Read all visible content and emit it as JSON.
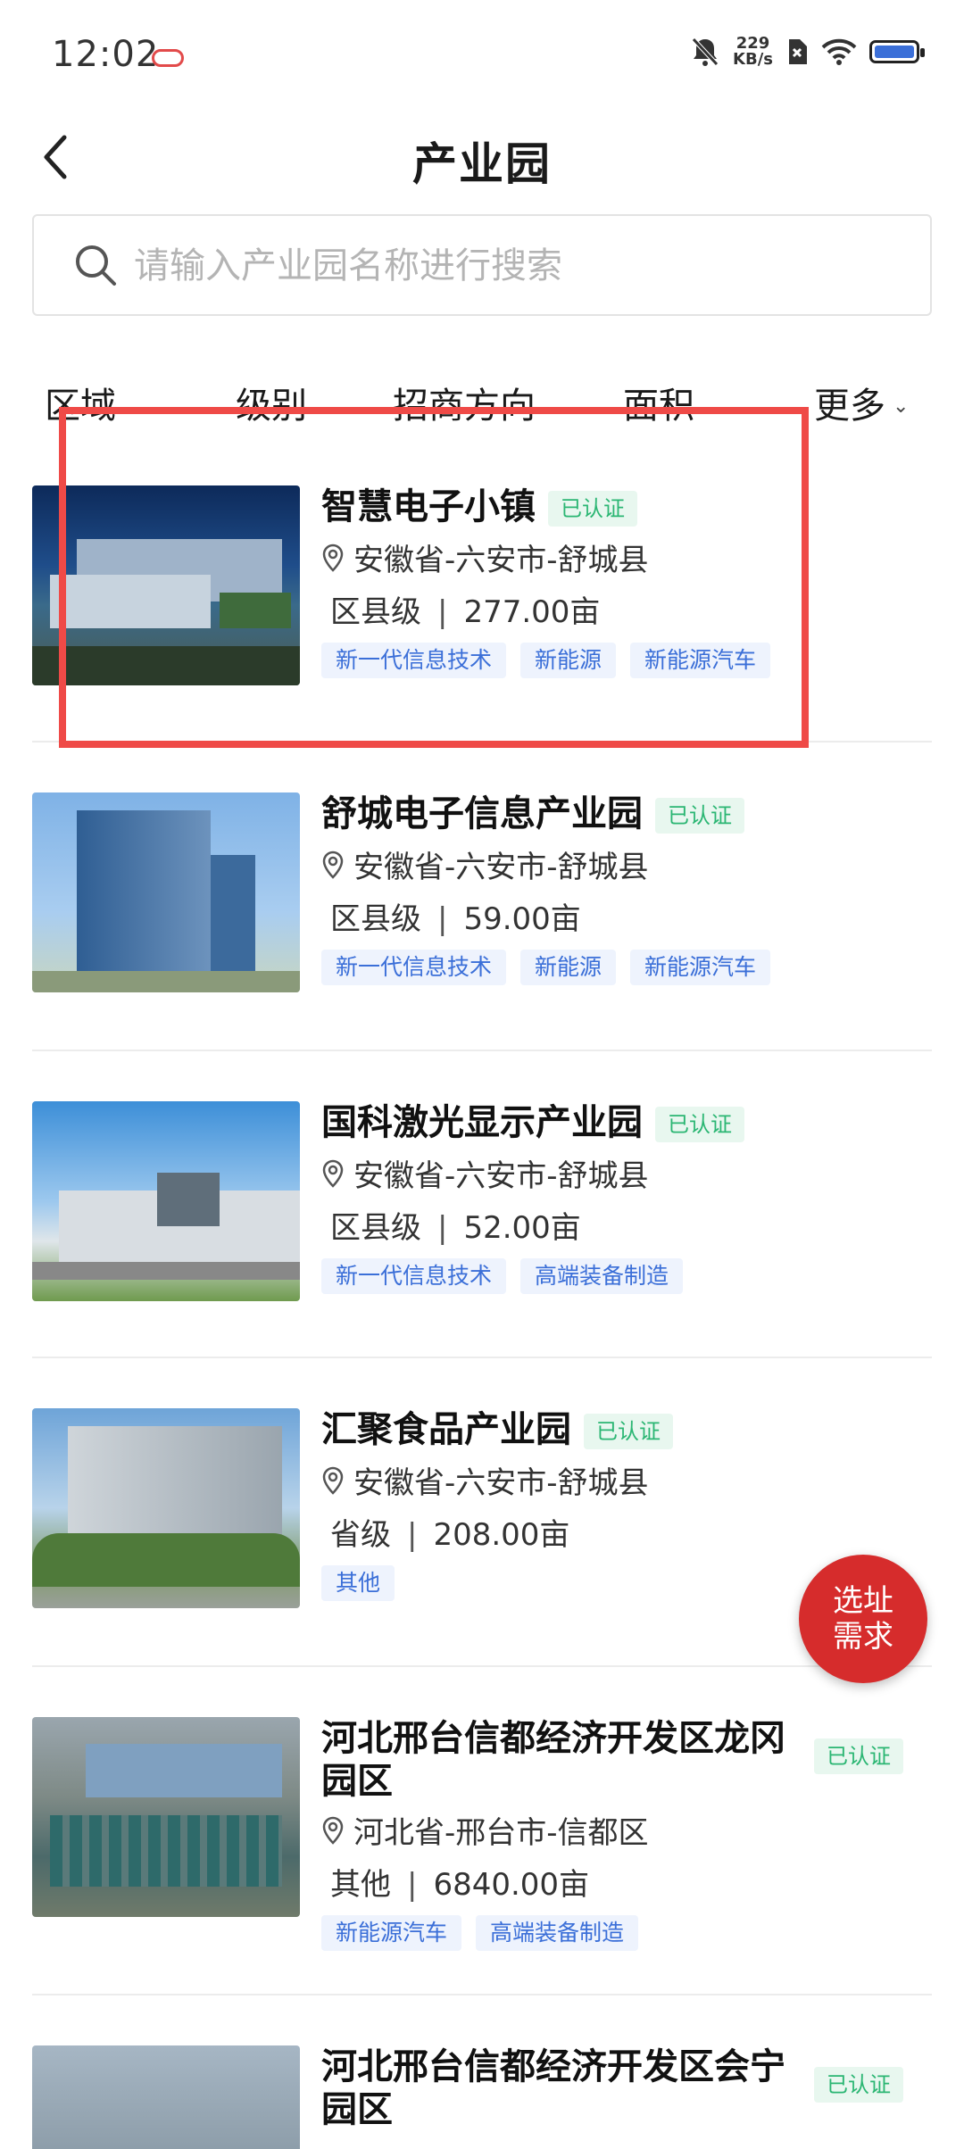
{
  "status": {
    "time": "12:02",
    "net_speed_value": "229",
    "net_speed_unit": "KB/s",
    "battery_color": "#3b6fd8"
  },
  "header": {
    "title": "产业园"
  },
  "search": {
    "placeholder": "请输入产业园名称进行搜索"
  },
  "filters": [
    {
      "label": "区域"
    },
    {
      "label": "级别"
    },
    {
      "label": "招商方向"
    },
    {
      "label": "面积"
    },
    {
      "label": "更多"
    }
  ],
  "parks": [
    {
      "name": "智慧电子小镇",
      "badge": "已认证",
      "location": "安徽省-六安市-舒城县",
      "level": "区县级",
      "sep": "|",
      "area": "277.00亩",
      "tags": [
        "新一代信息技术",
        "新能源",
        "新能源汽车"
      ]
    },
    {
      "name": "舒城电子信息产业园",
      "badge": "已认证",
      "location": "安徽省-六安市-舒城县",
      "level": "区县级",
      "sep": "|",
      "area": "59.00亩",
      "tags": [
        "新一代信息技术",
        "新能源",
        "新能源汽车"
      ]
    },
    {
      "name": "国科激光显示产业园",
      "badge": "已认证",
      "location": "安徽省-六安市-舒城县",
      "level": "区县级",
      "sep": "|",
      "area": "52.00亩",
      "tags": [
        "新一代信息技术",
        "高端装备制造"
      ]
    },
    {
      "name": "汇聚食品产业园",
      "badge": "已认证",
      "location": "安徽省-六安市-舒城县",
      "level": "省级",
      "sep": "|",
      "area": "208.00亩",
      "tags": [
        "其他"
      ]
    },
    {
      "name_line1": "河北邢台信都经济开发区龙冈",
      "name_line2": "园区",
      "badge": "已认证",
      "location": "河北省-邢台市-信都区",
      "level": "其他",
      "sep": "|",
      "area": "6840.00亩",
      "tags": [
        "新能源汽车",
        "高端装备制造"
      ]
    },
    {
      "name_line1": "河北邢台信都经济开发区会宁",
      "name_line2": "园区",
      "badge": "已认证"
    }
  ],
  "fab": {
    "line1": "选址",
    "line2": "需求"
  },
  "colors": {
    "accent_red": "#d62c2c",
    "badge_green": "#2bb673",
    "tag_blue": "#3b6fd8",
    "highlight_box": "#ef4a47"
  }
}
